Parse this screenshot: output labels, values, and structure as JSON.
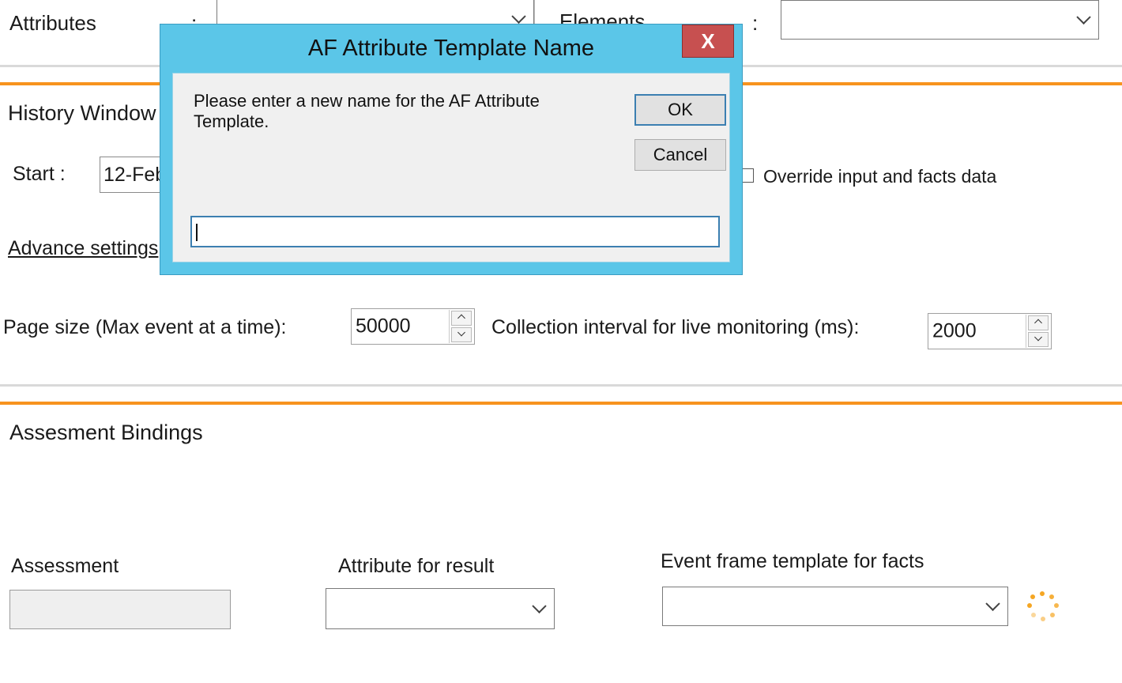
{
  "top": {
    "attributes_label": "Attributes",
    "attributes_colon": ":",
    "elements_label": "Elements",
    "elements_colon": ":"
  },
  "history": {
    "title": "History Window",
    "start_label": "Start :",
    "start_value": "12-Feb",
    "override_label": "Override input and facts data",
    "advance_link": "Advance settings",
    "page_size_label": "Page size (Max event at a time):",
    "page_size_value": "50000",
    "collection_label": "Collection interval for live monitoring (ms):",
    "collection_value": "2000"
  },
  "bindings": {
    "title": "Assesment Bindings",
    "assessment_label": "Assessment",
    "attribute_result_label": "Attribute for result",
    "event_frame_label": "Event frame template for facts"
  },
  "dialog": {
    "title": "AF Attribute Template Name",
    "close_glyph": "X",
    "message": "Please enter a new name for the AF Attribute Template.",
    "ok_label": "OK",
    "cancel_label": "Cancel",
    "input_value": ""
  },
  "colors": {
    "accent_orange": "#f7931e",
    "dialog_frame": "#5bc6e8",
    "close_red": "#c75050",
    "spinner": "#f5a623"
  },
  "icons": {
    "dropdown": "chevron-down-icon",
    "close": "close-icon",
    "loading": "loading-spinner-icon"
  }
}
